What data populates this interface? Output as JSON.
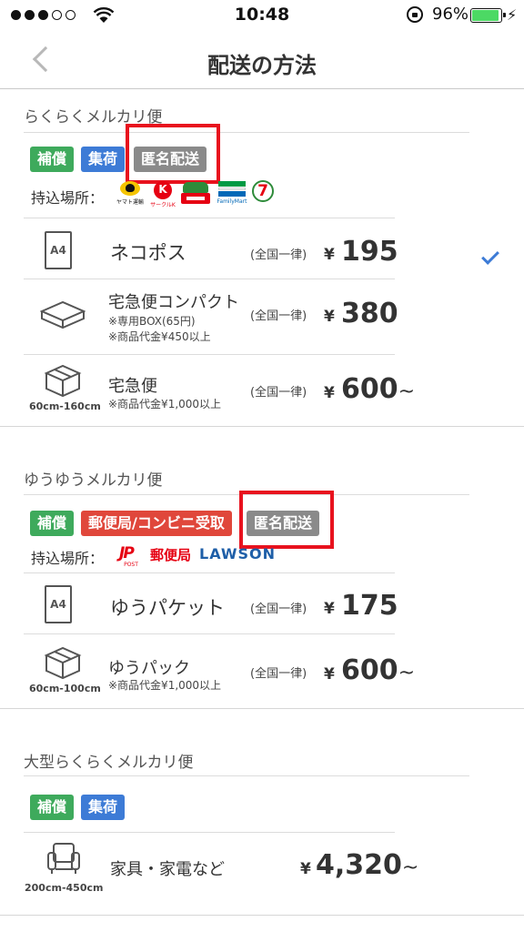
{
  "status_bar": {
    "time": "10:48",
    "battery": "96%",
    "battery_level": 0.96
  },
  "nav": {
    "title": "配送の方法"
  },
  "rakuraku": {
    "title": "らくらくメルカリ便",
    "tags": [
      "補償",
      "集荷",
      "匿名配送"
    ],
    "drop_label": "持込場所：",
    "logos": {
      "yamato": "ヤマト運輸",
      "circlek": "サークルK",
      "famima": "FamilyMart"
    },
    "rows": [
      {
        "name": "ネコポス",
        "region": "(全国一律)",
        "yen": "¥",
        "price": "195",
        "selected": true
      },
      {
        "name": "宅急便コンパクト",
        "note1": "※専用BOX(65円)",
        "note2": "※商品代金¥450以上",
        "region": "(全国一律)",
        "yen": "¥",
        "price": "380"
      },
      {
        "name": "宅急便",
        "note1": "※商品代金¥1,000以上",
        "size": "60cm-160cm",
        "region": "(全国一律)",
        "yen": "¥",
        "price": "600",
        "tilde": "~"
      }
    ]
  },
  "yuyu": {
    "title": "ゆうゆうメルカリ便",
    "tags": [
      "補償",
      "郵便局/コンビニ受取",
      "匿名配送"
    ],
    "drop_label": "持込場所：",
    "logos": {
      "jp": "JP",
      "jp_post": "POST",
      "yubinkyoku": "郵便局",
      "lawson": "LAWSON"
    },
    "rows": [
      {
        "name": "ゆうパケット",
        "region": "(全国一律)",
        "yen": "¥",
        "price": "175"
      },
      {
        "name": "ゆうパック",
        "note1": "※商品代金¥1,000以上",
        "size": "60cm-100cm",
        "region": "(全国一律)",
        "yen": "¥",
        "price": "600",
        "tilde": "~"
      }
    ]
  },
  "oogata": {
    "title": "大型らくらくメルカリ便",
    "tags": [
      "補償",
      "集荷"
    ],
    "rows": [
      {
        "name": "家具・家電など",
        "size": "200cm-450cm",
        "yen": "¥",
        "price": "4,320",
        "tilde": "~"
      }
    ]
  },
  "icons": [
    "wifi-icon",
    "lock-rotation-icon",
    "battery-icon",
    "back-chevron-icon",
    "a4-envelope-icon",
    "flat-box-icon",
    "box-icon",
    "armchair-icon",
    "checkmark-icon"
  ],
  "colors": {
    "green_tag": "#3eaa5c",
    "blue_tag": "#3d7bd6",
    "red_tag": "#e0473b",
    "gray_tag": "#8a8a8a",
    "highlight": "#e8121e",
    "battery": "#4cd964"
  }
}
